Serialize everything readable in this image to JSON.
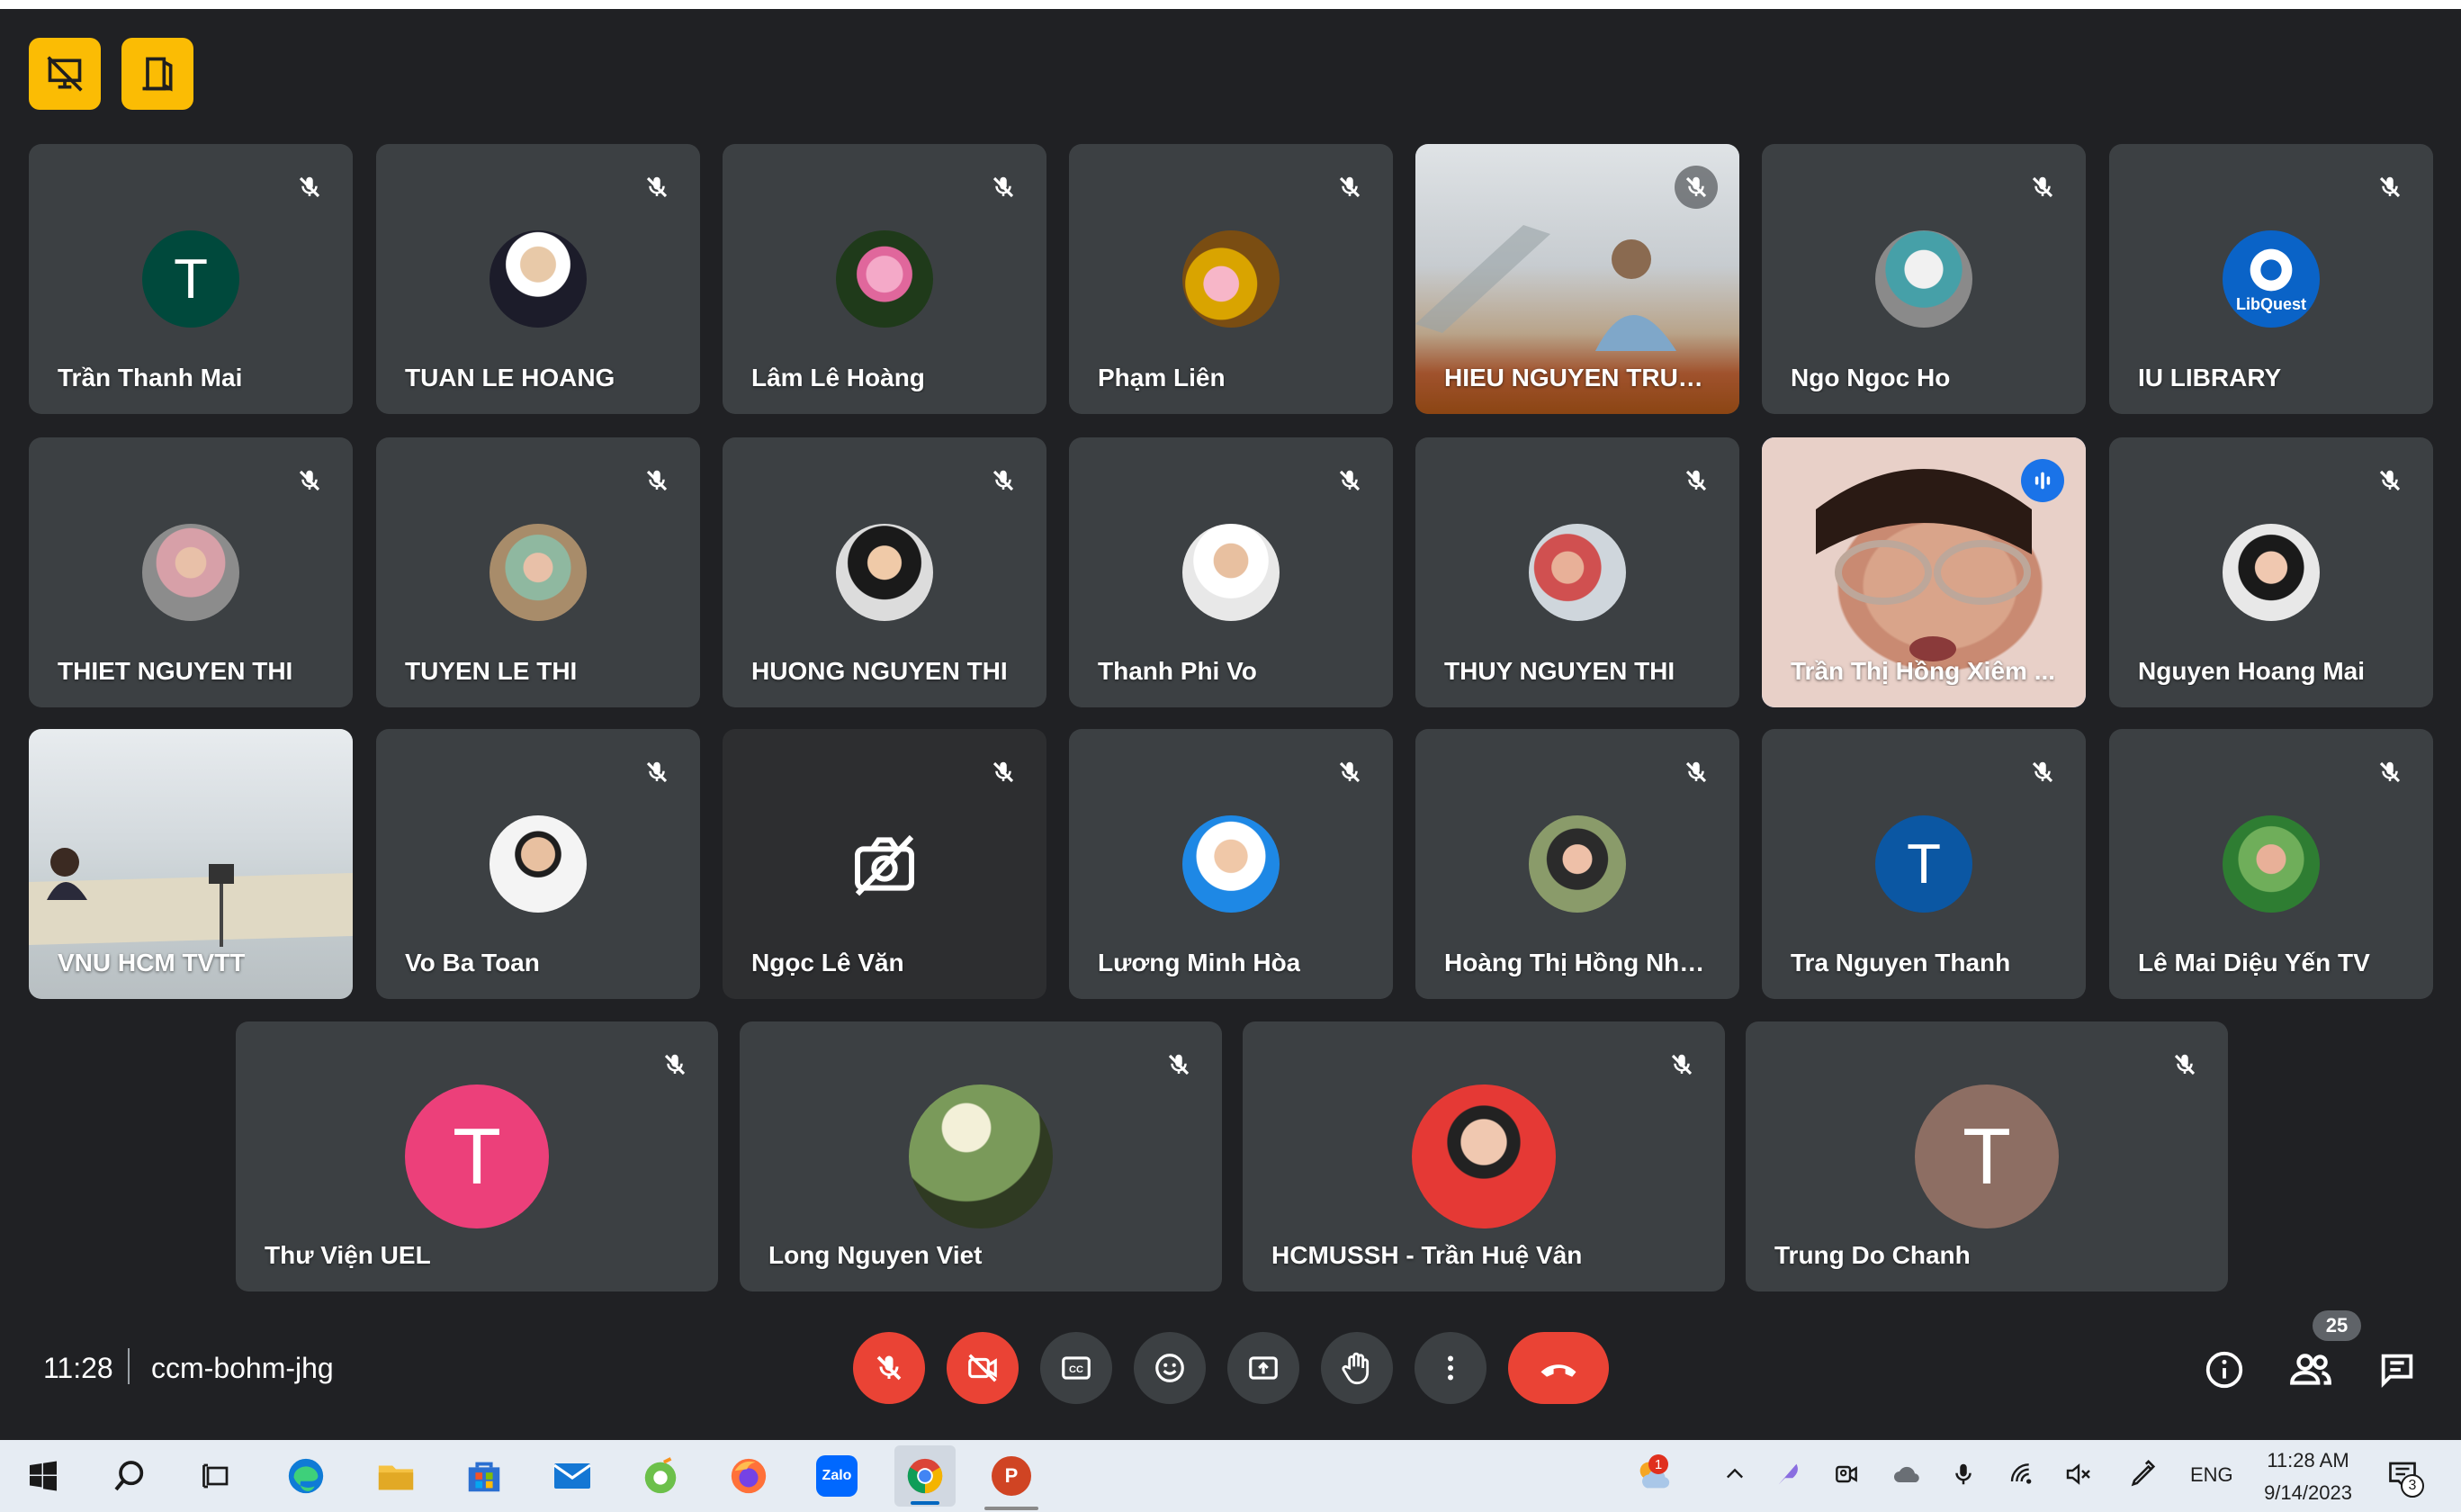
{
  "meeting": {
    "time": "11:28",
    "code": "ccm-bohm-jhg",
    "participant_count": "25"
  },
  "top_buttons": [
    {
      "icon": "presentation-off-icon"
    },
    {
      "icon": "exit-room-icon"
    }
  ],
  "participants": [
    {
      "name": "Trần Thanh Mai",
      "avatar": "T",
      "avatar_color": "#00493c",
      "muted": true
    },
    {
      "name": "TUAN LE HOANG",
      "muted": true
    },
    {
      "name": "Lâm Lê Hoàng",
      "muted": true
    },
    {
      "name": "Phạm Liên",
      "muted": true
    },
    {
      "name": "HIEU NGUYEN TRUNG",
      "muted": true
    },
    {
      "name": "Ngo Ngoc Ho",
      "muted": true
    },
    {
      "name": "IU LIBRARY",
      "avatar": "LibQuest",
      "muted": true
    },
    {
      "name": "THIET NGUYEN THI",
      "muted": true
    },
    {
      "name": "TUYEN LE THI",
      "muted": true
    },
    {
      "name": "HUONG NGUYEN THI",
      "muted": true
    },
    {
      "name": "Thanh Phi Vo",
      "muted": true
    },
    {
      "name": "THUY NGUYEN THI",
      "muted": true
    },
    {
      "name": "Trần Thị Hồng Xiêm ...",
      "speaking": true
    },
    {
      "name": "Nguyen Hoang Mai",
      "muted": true
    },
    {
      "name": "VNU HCM TVTT"
    },
    {
      "name": "Vo Ba Toan",
      "muted": true
    },
    {
      "name": "Ngọc Lê Văn",
      "muted": true,
      "camera_off": true
    },
    {
      "name": "Lương Minh Hòa",
      "muted": true
    },
    {
      "name": "Hoàng Thị Hồng Nhu...",
      "muted": true
    },
    {
      "name": "Tra Nguyen Thanh",
      "avatar": "T",
      "avatar_color": "#0b57a3",
      "muted": true
    },
    {
      "name": "Lê Mai Diệu Yến TV",
      "muted": true
    },
    {
      "name": "Thư Viện UEL",
      "avatar": "T",
      "avatar_color": "#ec407a",
      "muted": true
    },
    {
      "name": "Long Nguyen Viet",
      "muted": true
    },
    {
      "name": "HCMUSSH - Trần Huệ Vân",
      "muted": true
    },
    {
      "name": "Trung Do Chanh",
      "avatar": "T",
      "avatar_color": "#8d6e63",
      "muted": true
    }
  ],
  "controls": [
    "mic-off-icon",
    "camera-off-icon",
    "captions-icon",
    "emoji-icon",
    "present-icon",
    "raise-hand-icon",
    "more-options-icon",
    "end-call-icon"
  ],
  "right_controls": [
    "info-icon",
    "people-icon",
    "chat-icon"
  ],
  "taskbar": {
    "apps": [
      "windows-start-icon",
      "search-icon",
      "task-view-icon",
      "edge-icon",
      "file-explorer-icon",
      "store-icon",
      "mail-icon",
      "green-app-icon",
      "firefox-icon",
      "zalo-icon",
      "chrome-icon",
      "powerpoint-icon"
    ],
    "zalo_label": "Zalo",
    "ppt_label": "P",
    "notification_badge": "1",
    "language": "ENG",
    "time": "11:28 AM",
    "date": "9/14/2023",
    "notif_count": "3"
  }
}
